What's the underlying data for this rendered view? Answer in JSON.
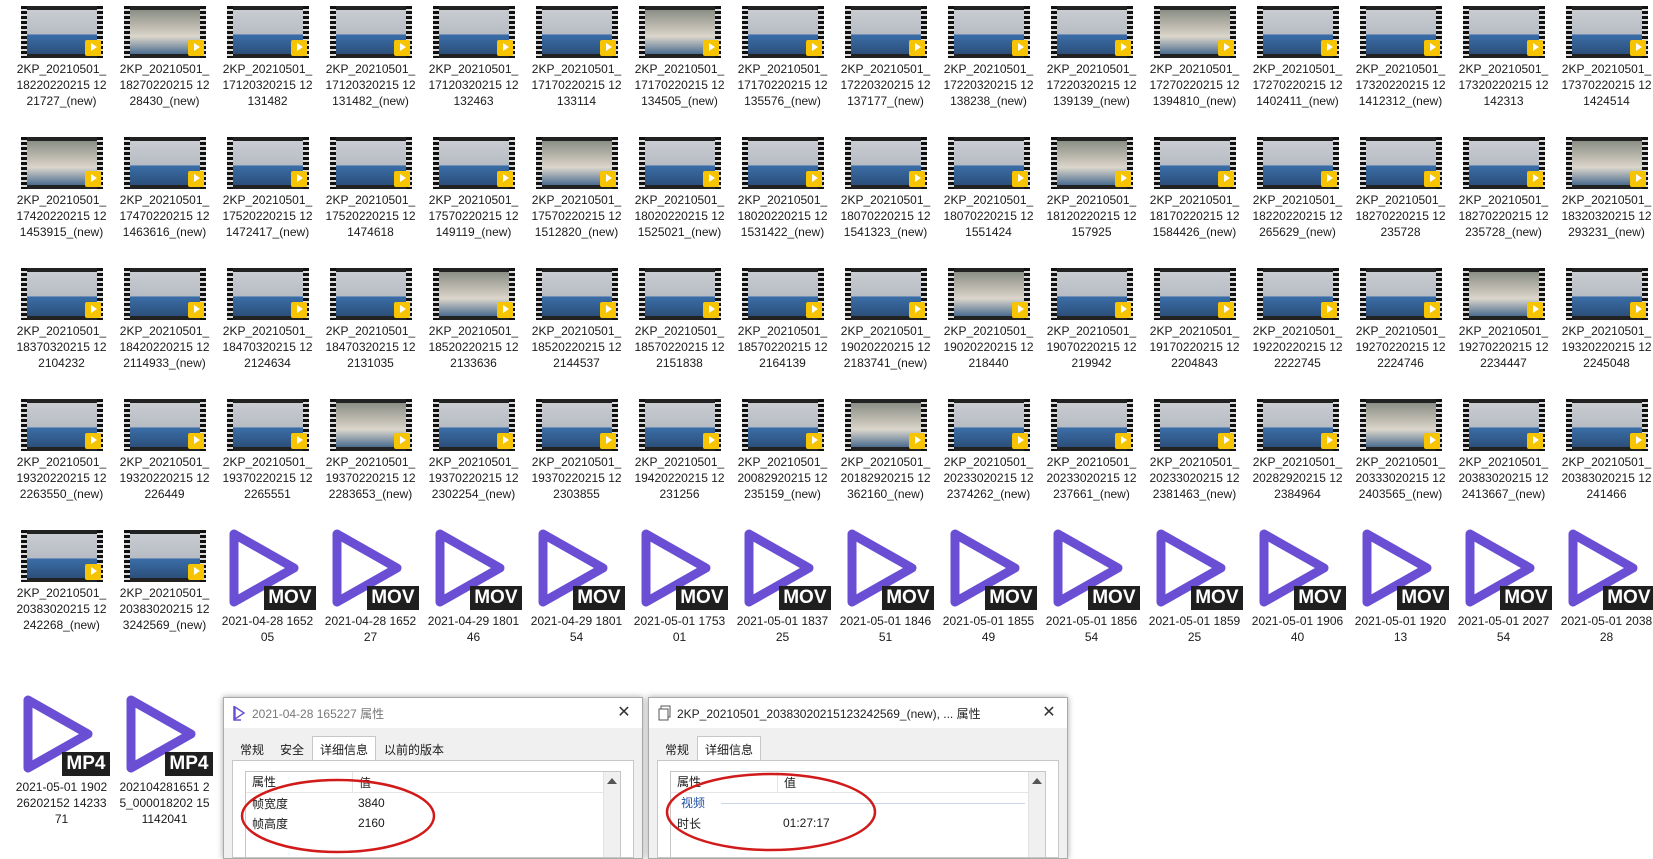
{
  "window": {
    "title": ""
  },
  "colors": {
    "accent_purple": "#6a4fd4",
    "mov_badge": "#1f1f1f",
    "player_badge": "#f6c400",
    "annotation_red": "#d11a1a"
  },
  "files": [
    {
      "label": "2KP_20210501_18220220215 1221727_(new)",
      "kind": "video"
    },
    {
      "label": "2KP_20210501_18270220215 1228430_(new)",
      "kind": "video"
    },
    {
      "label": "2KP_20210501_17120320215 12131482",
      "kind": "video"
    },
    {
      "label": "2KP_20210501_17120320215 12131482_(new)",
      "kind": "video"
    },
    {
      "label": "2KP_20210501_17120320215 12132463",
      "kind": "video"
    },
    {
      "label": "2KP_20210501_17170220215 12133114",
      "kind": "video"
    },
    {
      "label": "2KP_20210501_17170220215 12134505_(new)",
      "kind": "video"
    },
    {
      "label": "2KP_20210501_17170220215 12135576_(new)",
      "kind": "video"
    },
    {
      "label": "2KP_20210501_17220320215 12137177_(new)",
      "kind": "video"
    },
    {
      "label": "2KP_20210501_17220320215 12138238_(new)",
      "kind": "video"
    },
    {
      "label": "2KP_20210501_17220320215 12139139_(new)",
      "kind": "video"
    },
    {
      "label": "2KP_20210501_17270220215 121394810_(new)",
      "kind": "video"
    },
    {
      "label": "2KP_20210501_17270220215 121402411_(new)",
      "kind": "video"
    },
    {
      "label": "2KP_20210501_17320220215 121412312_(new)",
      "kind": "video"
    },
    {
      "label": "2KP_20210501_17320220215 12142313",
      "kind": "video"
    },
    {
      "label": "2KP_20210501_17370220215 121424514",
      "kind": "video"
    },
    {
      "label": "2KP_20210501_17420220215 121453915_(new)",
      "kind": "video"
    },
    {
      "label": "2KP_20210501_17470220215 121463616_(new)",
      "kind": "video"
    },
    {
      "label": "2KP_20210501_17520220215 121472417_(new)",
      "kind": "video"
    },
    {
      "label": "2KP_20210501_17520220215 121474618",
      "kind": "video"
    },
    {
      "label": "2KP_20210501_17570220215 12149119_(new)",
      "kind": "video"
    },
    {
      "label": "2KP_20210501_17570220215 121512820_(new)",
      "kind": "video"
    },
    {
      "label": "2KP_20210501_18020220215 121525021_(new)",
      "kind": "video"
    },
    {
      "label": "2KP_20210501_18020220215 121531422_(new)",
      "kind": "video"
    },
    {
      "label": "2KP_20210501_18070220215 121541323_(new)",
      "kind": "video"
    },
    {
      "label": "2KP_20210501_18070220215 121551424",
      "kind": "video"
    },
    {
      "label": "2KP_20210501_18120220215 12157925",
      "kind": "video"
    },
    {
      "label": "2KP_20210501_18170220215 121584426_(new)",
      "kind": "video"
    },
    {
      "label": "2KP_20210501_18220220215 12265629_(new)",
      "kind": "video"
    },
    {
      "label": "2KP_20210501_18270220215 12235728",
      "kind": "video"
    },
    {
      "label": "2KP_20210501_18270220215 12235728_(new)",
      "kind": "video"
    },
    {
      "label": "2KP_20210501_18320320215 12293231_(new)",
      "kind": "video"
    },
    {
      "label": "2KP_20210501_18370320215 122104232",
      "kind": "video"
    },
    {
      "label": "2KP_20210501_18420220215 122114933_(new)",
      "kind": "video"
    },
    {
      "label": "2KP_20210501_18470320215 122124634",
      "kind": "video"
    },
    {
      "label": "2KP_20210501_18470320215 122131035",
      "kind": "video"
    },
    {
      "label": "2KP_20210501_18520220215 122133636",
      "kind": "video"
    },
    {
      "label": "2KP_20210501_18520220215 122144537",
      "kind": "video"
    },
    {
      "label": "2KP_20210501_18570220215 122151838",
      "kind": "video"
    },
    {
      "label": "2KP_20210501_18570220215 122164139",
      "kind": "video"
    },
    {
      "label": "2KP_20210501_19020220215 122183741_(new)",
      "kind": "video"
    },
    {
      "label": "2KP_20210501_19020220215 12218440",
      "kind": "video"
    },
    {
      "label": "2KP_20210501_19070220215 12219942",
      "kind": "video"
    },
    {
      "label": "2KP_20210501_19170220215 122204843",
      "kind": "video"
    },
    {
      "label": "2KP_20210501_19220220215 122222745",
      "kind": "video"
    },
    {
      "label": "2KP_20210501_19270220215 122224746",
      "kind": "video"
    },
    {
      "label": "2KP_20210501_19270220215 122234447",
      "kind": "video"
    },
    {
      "label": "2KP_20210501_19320220215 122245048",
      "kind": "video"
    },
    {
      "label": "2KP_20210501_19320220215 122263550_(new)",
      "kind": "video"
    },
    {
      "label": "2KP_20210501_19320220215 12226449",
      "kind": "video"
    },
    {
      "label": "2KP_20210501_19370220215 122265551",
      "kind": "video"
    },
    {
      "label": "2KP_20210501_19370220215 122283653_(new)",
      "kind": "video"
    },
    {
      "label": "2KP_20210501_19370220215 122302254_(new)",
      "kind": "video"
    },
    {
      "label": "2KP_20210501_19370220215 122303855",
      "kind": "video"
    },
    {
      "label": "2KP_20210501_19420220215 12231256",
      "kind": "video"
    },
    {
      "label": "2KP_20210501_20082920215 12235159_(new)",
      "kind": "video"
    },
    {
      "label": "2KP_20210501_20182920215 12362160_(new)",
      "kind": "video"
    },
    {
      "label": "2KP_20210501_20233020215 122374262_(new)",
      "kind": "video"
    },
    {
      "label": "2KP_20210501_20233020215 12237661_(new)",
      "kind": "video"
    },
    {
      "label": "2KP_20210501_20233020215 122381463_(new)",
      "kind": "video"
    },
    {
      "label": "2KP_20210501_20282920215 122384964",
      "kind": "video"
    },
    {
      "label": "2KP_20210501_20333020215 122403565_(new)",
      "kind": "video"
    },
    {
      "label": "2KP_20210501_20383020215 122413667_(new)",
      "kind": "video"
    },
    {
      "label": "2KP_20210501_20383020215 12241466",
      "kind": "video"
    },
    {
      "label": "2KP_20210501_20383020215 12242268_(new)",
      "kind": "video"
    },
    {
      "label": "2KP_20210501_20383020215 123242569_(new)",
      "kind": "video"
    },
    {
      "label": "2021-04-28 165205",
      "kind": "mov",
      "tag": "MOV"
    },
    {
      "label": "2021-04-28 165227",
      "kind": "mov",
      "tag": "MOV"
    },
    {
      "label": "2021-04-29 180146",
      "kind": "mov",
      "tag": "MOV"
    },
    {
      "label": "2021-04-29 180154",
      "kind": "mov",
      "tag": "MOV"
    },
    {
      "label": "2021-05-01 175301",
      "kind": "mov",
      "tag": "MOV"
    },
    {
      "label": "2021-05-01 183725",
      "kind": "mov",
      "tag": "MOV"
    },
    {
      "label": "2021-05-01 184651",
      "kind": "mov",
      "tag": "MOV"
    },
    {
      "label": "2021-05-01 185549",
      "kind": "mov",
      "tag": "MOV"
    },
    {
      "label": "2021-05-01 185654",
      "kind": "mov",
      "tag": "MOV"
    },
    {
      "label": "2021-05-01 185925",
      "kind": "mov",
      "tag": "MOV"
    },
    {
      "label": "2021-05-01 190640",
      "kind": "mov",
      "tag": "MOV"
    },
    {
      "label": "2021-05-01 192013",
      "kind": "mov",
      "tag": "MOV"
    },
    {
      "label": "2021-05-01 202754",
      "kind": "mov",
      "tag": "MOV"
    },
    {
      "label": "2021-05-01 203828",
      "kind": "mov",
      "tag": "MOV"
    },
    {
      "label": "2021-05-01 190226202152 1423371",
      "kind": "mp4",
      "tag": "MP4"
    },
    {
      "label": "202104281651 25_000018202 151142041",
      "kind": "mp4",
      "tag": "MP4"
    }
  ],
  "dialog1": {
    "title": "2021-04-28 165227 属性",
    "tabs": [
      "常规",
      "安全",
      "详细信息",
      "以前的版本"
    ],
    "active_tab": "详细信息",
    "header": {
      "col1": "属性",
      "col2": "值"
    },
    "rows": [
      {
        "name": "帧宽度",
        "value": "3840"
      },
      {
        "name": "帧高度",
        "value": "2160"
      }
    ],
    "close": "✕"
  },
  "dialog2": {
    "title": "2KP_20210501_20383020215123242569_(new), ... 属性",
    "tabs": [
      "常规",
      "详细信息"
    ],
    "active_tab": "详细信息",
    "header": {
      "col1": "属性",
      "col2": "值"
    },
    "group": "视频",
    "rows": [
      {
        "name": "时长",
        "value": "01:27:17"
      }
    ],
    "close": "✕"
  }
}
